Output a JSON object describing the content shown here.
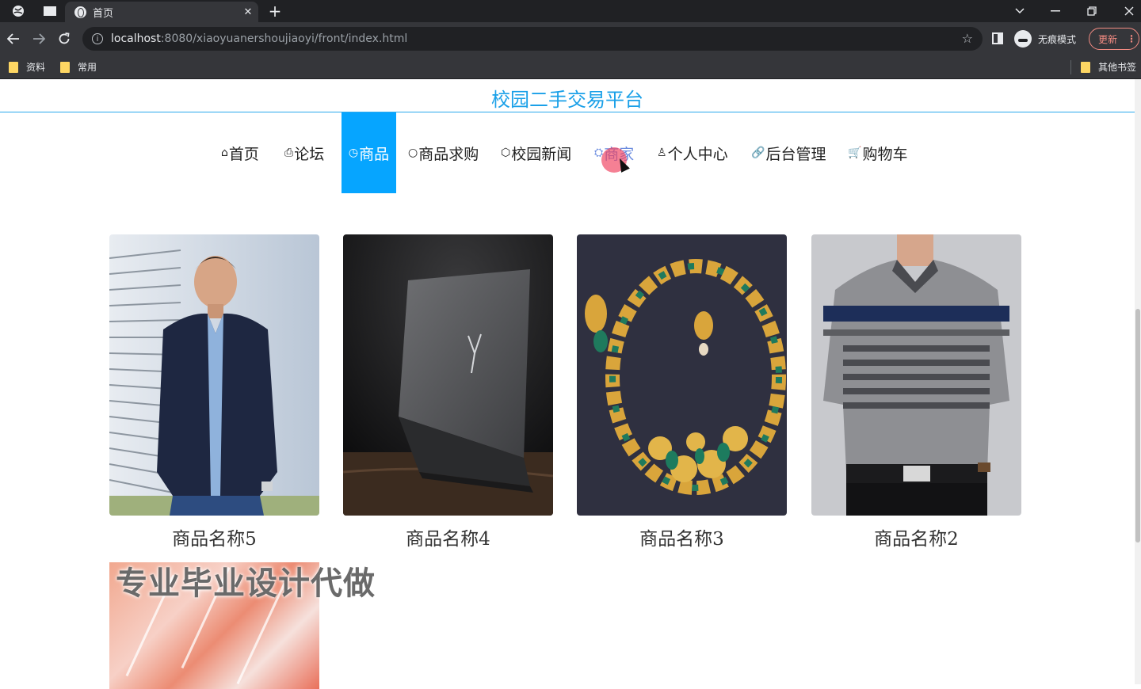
{
  "browser": {
    "tab_title": "首页",
    "url_host": "localhost",
    "url_path": ":8080/xiaoyuanershoujiaoyi/front/index.html",
    "incognito_label": "无痕模式",
    "update_label": "更新",
    "bookmarks": [
      "资料",
      "常用"
    ],
    "other_bookmarks": "其他书签"
  },
  "site": {
    "title": "校园二手交易平台"
  },
  "menu": [
    {
      "icon": "⌂",
      "label": "首页"
    },
    {
      "icon": "⎙",
      "label": "论坛"
    },
    {
      "icon": "◷",
      "label": "商品"
    },
    {
      "icon": "○",
      "label": "商品求购"
    },
    {
      "icon": "⬡",
      "label": "校园新闻"
    },
    {
      "icon": "⛭",
      "label": "商家"
    },
    {
      "icon": "♙",
      "label": "个人中心"
    },
    {
      "icon": "🔗",
      "label": "后台管理"
    },
    {
      "icon": "🛒",
      "label": "购物车"
    }
  ],
  "active_menu": "商品",
  "products": [
    {
      "name": "商品名称5"
    },
    {
      "name": "商品名称4"
    },
    {
      "name": "商品名称3"
    },
    {
      "name": "商品名称2"
    }
  ],
  "watermark": "专业毕业设计代做",
  "colors": {
    "accent": "#06a5ff",
    "title": "#1aa0e8"
  }
}
